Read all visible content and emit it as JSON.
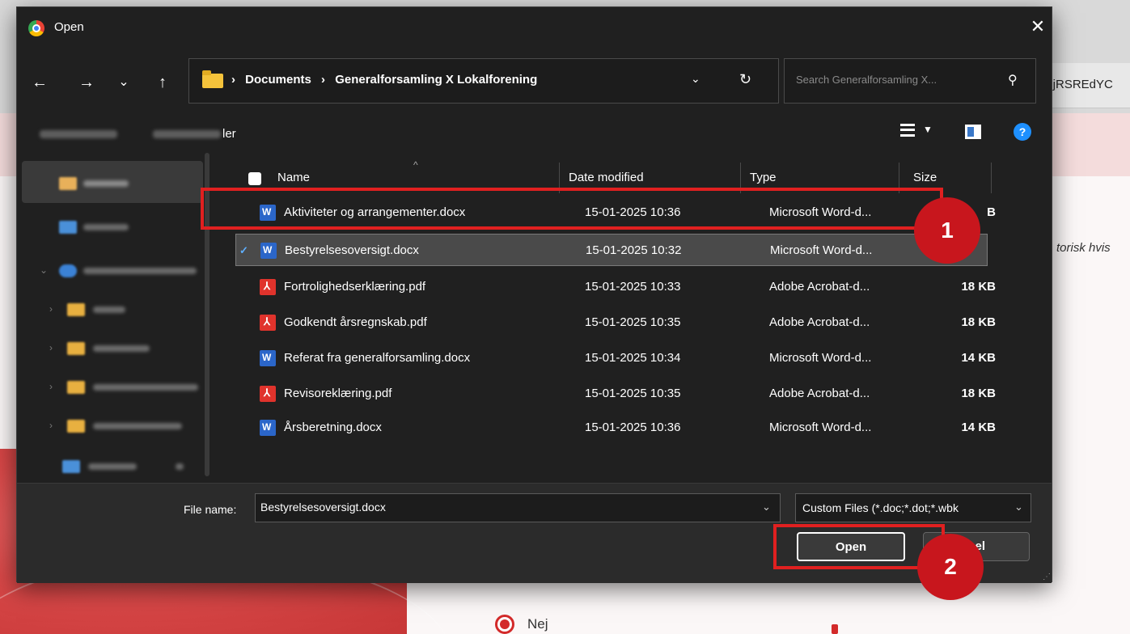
{
  "background": {
    "address_fragment": "QjRSREdYC",
    "side_text": "torisk hvis",
    "radio_label": "Nej"
  },
  "dialog": {
    "title": "Open",
    "close_label": "✕",
    "nav": {
      "back": "←",
      "forward": "→",
      "recent": "⌄",
      "up": "↑"
    },
    "breadcrumb": [
      "Documents",
      "Generalforsamling X Lokalforening"
    ],
    "breadcrumb_sep": "›",
    "search_placeholder": "Search Generalforsamling X...",
    "toolbar": {
      "new_folder_partial": "ler"
    },
    "columns": {
      "name": "Name",
      "date": "Date modified",
      "type": "Type",
      "size": "Size"
    },
    "files": [
      {
        "name": "Aktiviteter og arrangementer.docx",
        "date": "15-01-2025 10:36",
        "type": "Microsoft Word-d...",
        "size": "B",
        "icon": "word-icon"
      },
      {
        "name": "Bestyrelsesoversigt.docx",
        "date": "15-01-2025 10:32",
        "type": "Microsoft Word-d...",
        "size": "",
        "icon": "word-icon",
        "selected": true
      },
      {
        "name": "Fortrolighedserklæring.pdf",
        "date": "15-01-2025 10:33",
        "type": "Adobe Acrobat-d...",
        "size": "18 KB",
        "icon": "pdf-icon"
      },
      {
        "name": "Godkendt årsregnskab.pdf",
        "date": "15-01-2025 10:35",
        "type": "Adobe Acrobat-d...",
        "size": "18 KB",
        "icon": "pdf-icon"
      },
      {
        "name": "Referat fra generalforsamling.docx",
        "date": "15-01-2025 10:34",
        "type": "Microsoft Word-d...",
        "size": "14 KB",
        "icon": "word-icon"
      },
      {
        "name": "Revisoreklæring.pdf",
        "date": "15-01-2025 10:35",
        "type": "Adobe Acrobat-d...",
        "size": "18 KB",
        "icon": "pdf-icon"
      },
      {
        "name": "Årsberetning.docx",
        "date": "15-01-2025 10:36",
        "type": "Microsoft Word-d...",
        "size": "14 KB",
        "icon": "word-icon"
      }
    ],
    "file_name_label": "File name:",
    "file_name_value": "Bestyrelsesoversigt.docx",
    "file_type_value": "Custom Files (*.doc;*.dot;*.wbk",
    "open_label": "Open",
    "cancel_label": "ncel"
  },
  "annotations": {
    "badge1": "1",
    "badge2": "2",
    "color": "#c8161d"
  }
}
